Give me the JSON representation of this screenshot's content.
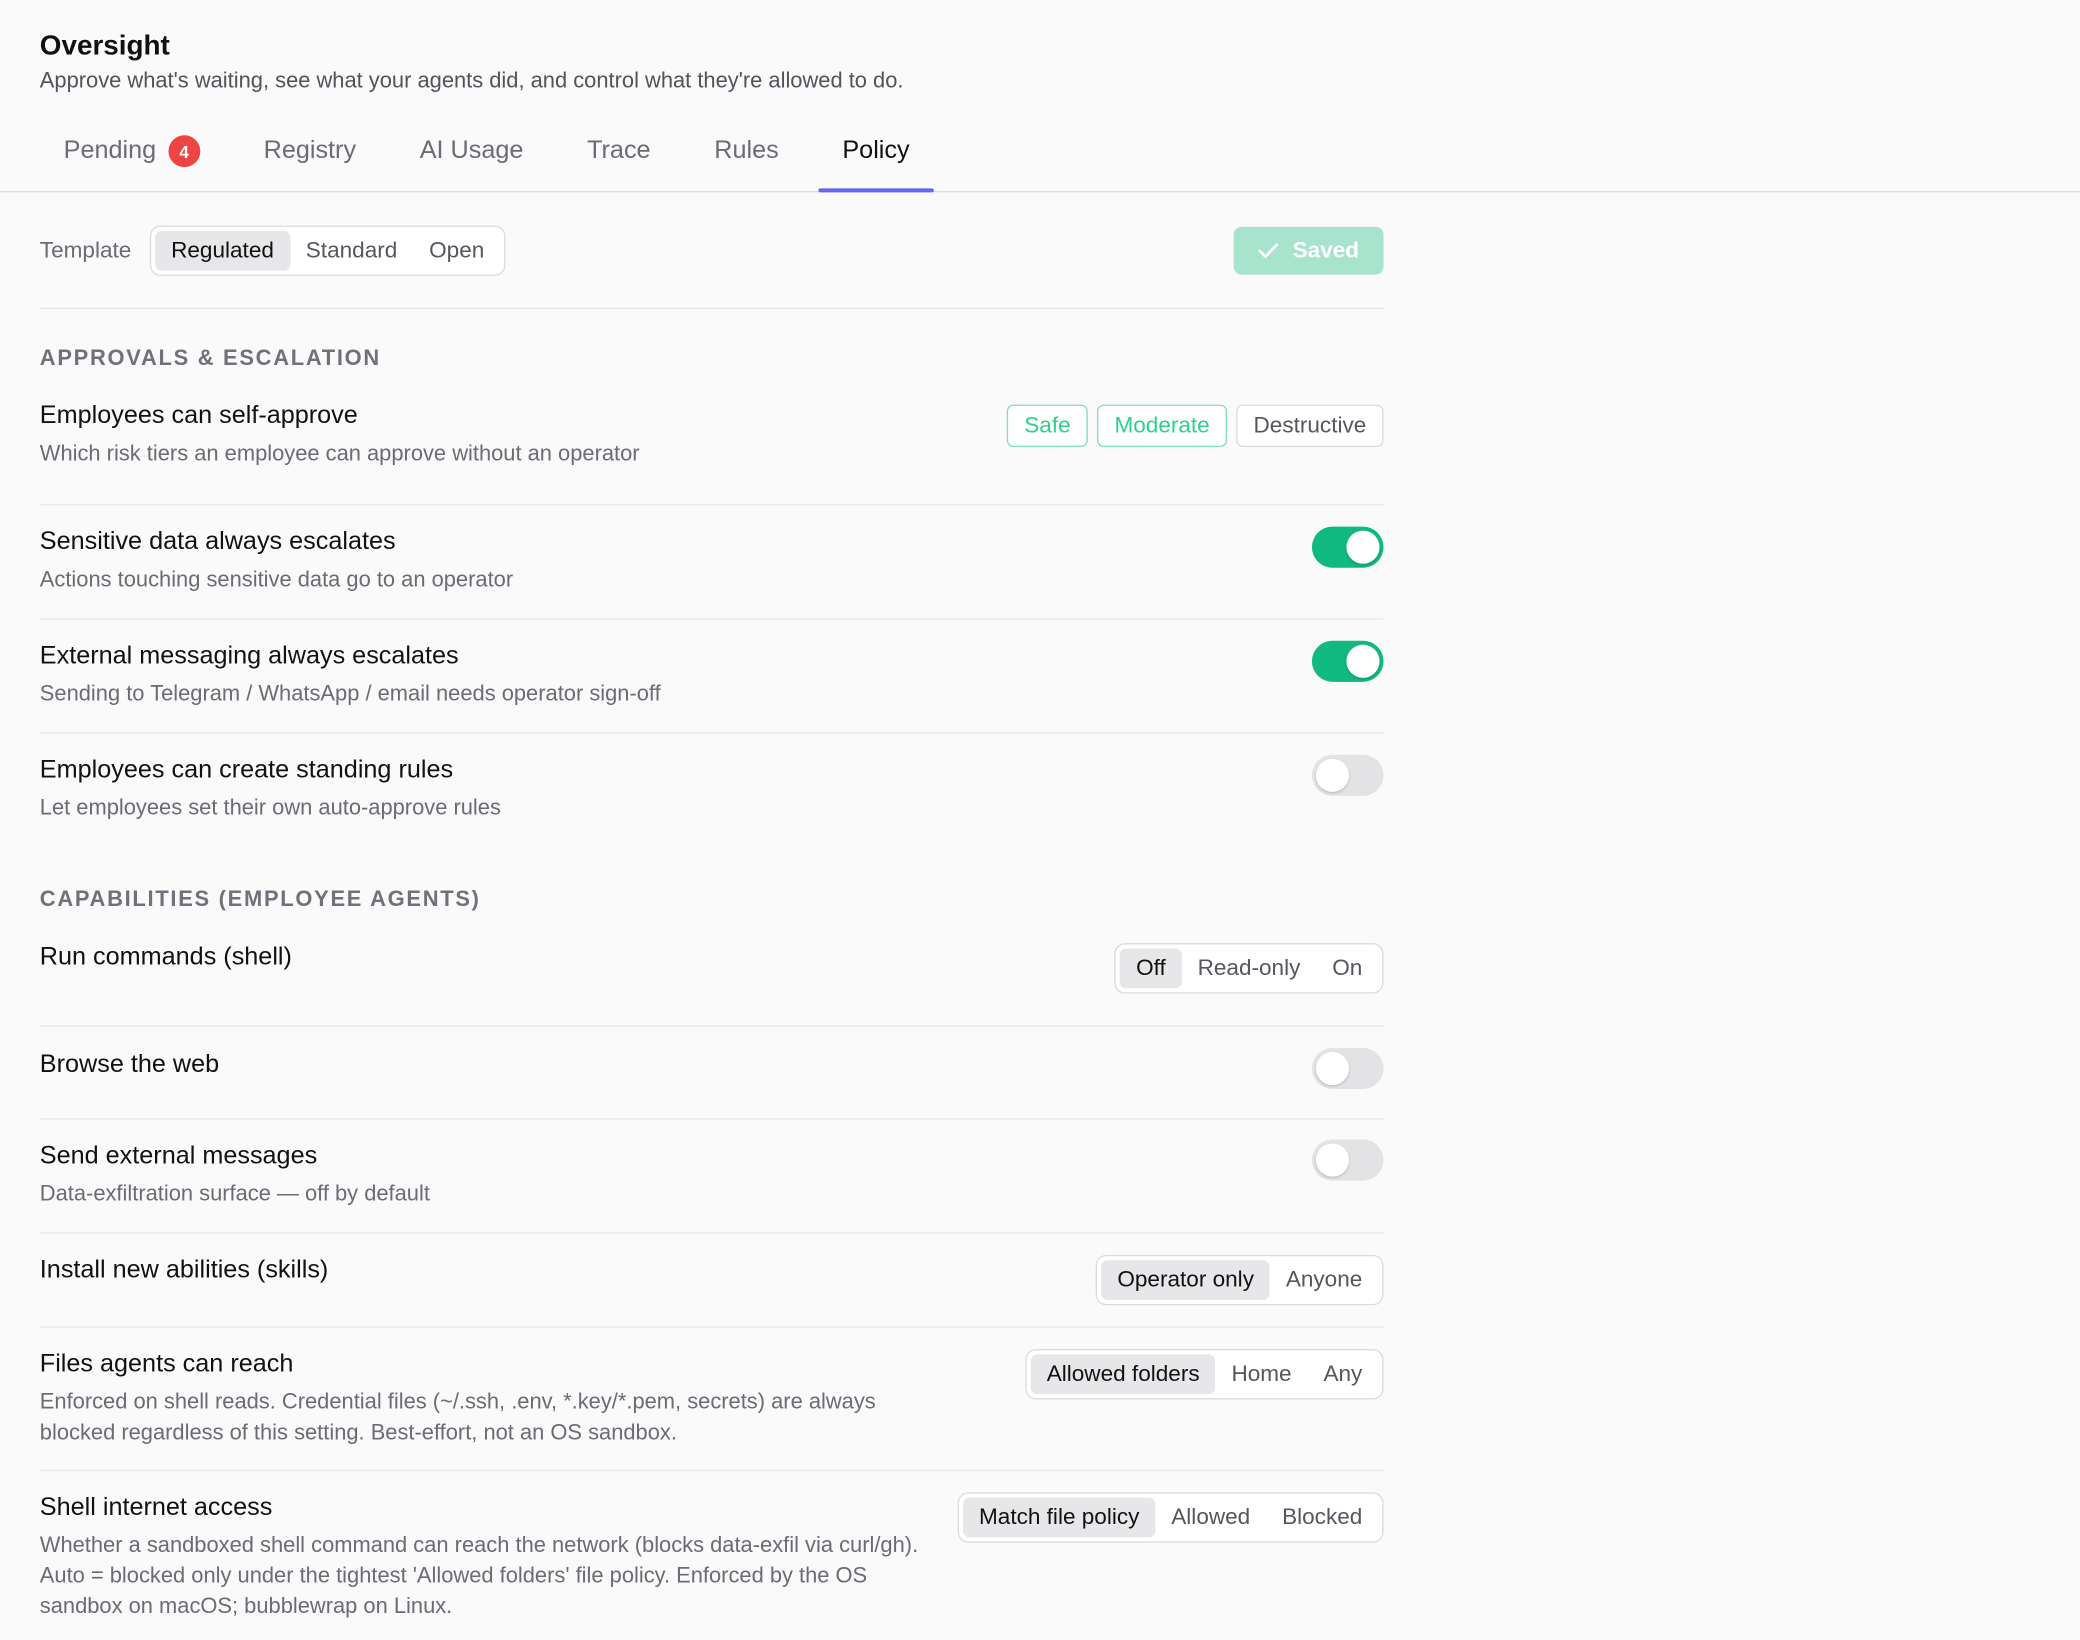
{
  "header": {
    "title": "Oversight",
    "subtitle": "Approve what's waiting, see what your agents did, and control what they're allowed to do."
  },
  "tabs": [
    {
      "label": "Pending",
      "badge": "4"
    },
    {
      "label": "Registry"
    },
    {
      "label": "AI Usage"
    },
    {
      "label": "Trace"
    },
    {
      "label": "Rules"
    },
    {
      "label": "Policy",
      "active": true
    }
  ],
  "template": {
    "label": "Template",
    "options": [
      "Regulated",
      "Standard",
      "Open"
    ],
    "selected": "Regulated",
    "saved_label": "Saved"
  },
  "approvals": {
    "title": "Approvals & Escalation",
    "self_approve": {
      "label": "Employees can self-approve",
      "desc": "Which risk tiers an employee can approve without an operator",
      "tiers": [
        "Safe",
        "Moderate",
        "Destructive"
      ],
      "selected": [
        "Safe",
        "Moderate"
      ]
    },
    "sensitive": {
      "label": "Sensitive data always escalates",
      "desc": "Actions touching sensitive data go to an operator",
      "enabled": true
    },
    "external": {
      "label": "External messaging always escalates",
      "desc": "Sending to Telegram / WhatsApp / email needs operator sign-off",
      "enabled": true
    },
    "standing": {
      "label": "Employees can create standing rules",
      "desc": "Let employees set their own auto-approve rules",
      "enabled": false
    }
  },
  "capabilities": {
    "title": "Capabilities (Employee Agents)",
    "shell": {
      "label": "Run commands (shell)",
      "options": [
        "Off",
        "Read-only",
        "On"
      ],
      "selected": "Off"
    },
    "web": {
      "label": "Browse the web",
      "enabled": false
    },
    "messages": {
      "label": "Send external messages",
      "desc": "Data-exfiltration surface — off by default",
      "enabled": false
    },
    "skills": {
      "label": "Install new abilities (skills)",
      "options": [
        "Operator only",
        "Anyone"
      ],
      "selected": "Operator only"
    },
    "files": {
      "label": "Files agents can reach",
      "desc": "Enforced on shell reads. Credential files (~/.ssh, .env, *.key/*.pem, secrets) are always blocked regardless of this setting. Best-effort, not an OS sandbox.",
      "options": [
        "Allowed folders",
        "Home",
        "Any"
      ],
      "selected": "Allowed folders"
    },
    "internet": {
      "label": "Shell internet access",
      "desc": "Whether a sandboxed shell command can reach the network (blocks data-exfil via curl/gh). Auto = blocked only under the tightest 'Allowed folders' file policy. Enforced by the OS sandbox on macOS; bubblewrap on Linux.",
      "options": [
        "Match file policy",
        "Allowed",
        "Blocked"
      ],
      "selected": "Match file policy"
    }
  },
  "colors": {
    "accent": "#6366f1",
    "toggle_on": "#10b97f",
    "badge": "#ef4444",
    "saved": "#a7e3cd"
  }
}
